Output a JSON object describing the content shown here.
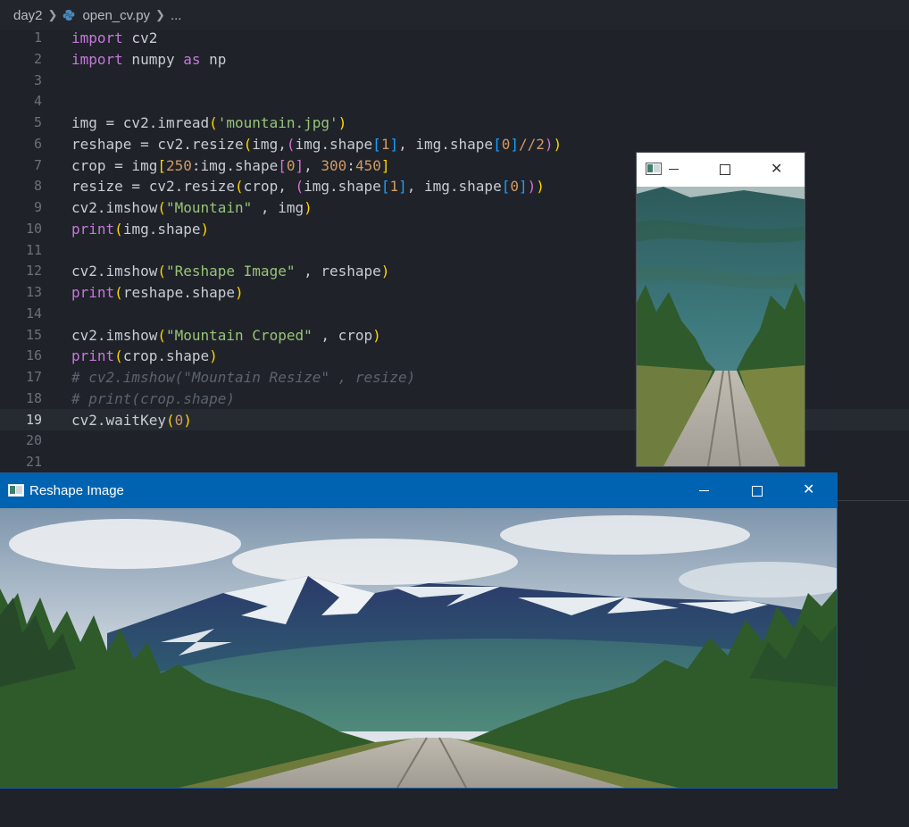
{
  "breadcrumb": {
    "folder": "day2",
    "file": "open_cv.py",
    "more": "..."
  },
  "current_line": 19,
  "code_lines": [
    {
      "n": "1"
    },
    {
      "n": "2"
    },
    {
      "n": "3"
    },
    {
      "n": "4"
    },
    {
      "n": "5"
    },
    {
      "n": "6"
    },
    {
      "n": "7"
    },
    {
      "n": "8"
    },
    {
      "n": "9"
    },
    {
      "n": "10"
    },
    {
      "n": "11"
    },
    {
      "n": "12"
    },
    {
      "n": "13"
    },
    {
      "n": "14"
    },
    {
      "n": "15"
    },
    {
      "n": "16"
    },
    {
      "n": "17"
    },
    {
      "n": "18"
    },
    {
      "n": "19"
    },
    {
      "n": "20"
    },
    {
      "n": "21"
    }
  ],
  "code": {
    "l1_kw": "import",
    "l1_rest": " cv2",
    "l2_kw": "import",
    "l2_mid": " numpy ",
    "l2_as": "as",
    "l2_np": " np",
    "l5_a": "img = cv2.imread",
    "l5_str": "'mountain.jpg'",
    "l6_a": "reshape = cv2.resize",
    "l6_b": "img,",
    "l6_c": "img.shape",
    "l6_i1": "1",
    "l6_d": ", img.shape",
    "l6_i0": "0",
    "l6_div": "//2",
    "l7_a": "crop = img",
    "l7_n1": "250",
    "l7_b": ":img.shape",
    "l7_i0": "0",
    "l7_c": ", ",
    "l7_n2": "300",
    "l7_colon": ":",
    "l7_n3": "450",
    "l8_a": "resize = cv2.resize",
    "l8_b": "crop, ",
    "l8_c": "img.shape",
    "l8_i1": "1",
    "l8_d": ", img.shape",
    "l8_i0": "0",
    "l9_a": "cv2.imshow",
    "l9_str": "\"Mountain\"",
    "l9_b": " , img",
    "l10_a": "print",
    "l10_b": "img.shape",
    "l12_a": "cv2.imshow",
    "l12_str": "\"Reshape Image\"",
    "l12_b": " , reshape",
    "l13_a": "print",
    "l13_b": "reshape.shape",
    "l15_a": "cv2.imshow",
    "l15_str": "\"Mountain Croped\"",
    "l15_b": " , crop",
    "l16_a": "print",
    "l16_b": "crop.shape",
    "l17": "# cv2.imshow(\"Mountain Resize\" , resize)",
    "l18": "# print(crop.shape)",
    "l19_a": "cv2.waitKey",
    "l19_n": "0"
  },
  "window_small": {
    "title": ""
  },
  "window_large": {
    "title": "Reshape Image"
  },
  "colors": {
    "titlebar_active": "#0063b1",
    "editor_bg": "#1f2228",
    "keyword": "#c678dd",
    "string": "#98c379",
    "number": "#d19a66",
    "comment": "#5c6370"
  }
}
